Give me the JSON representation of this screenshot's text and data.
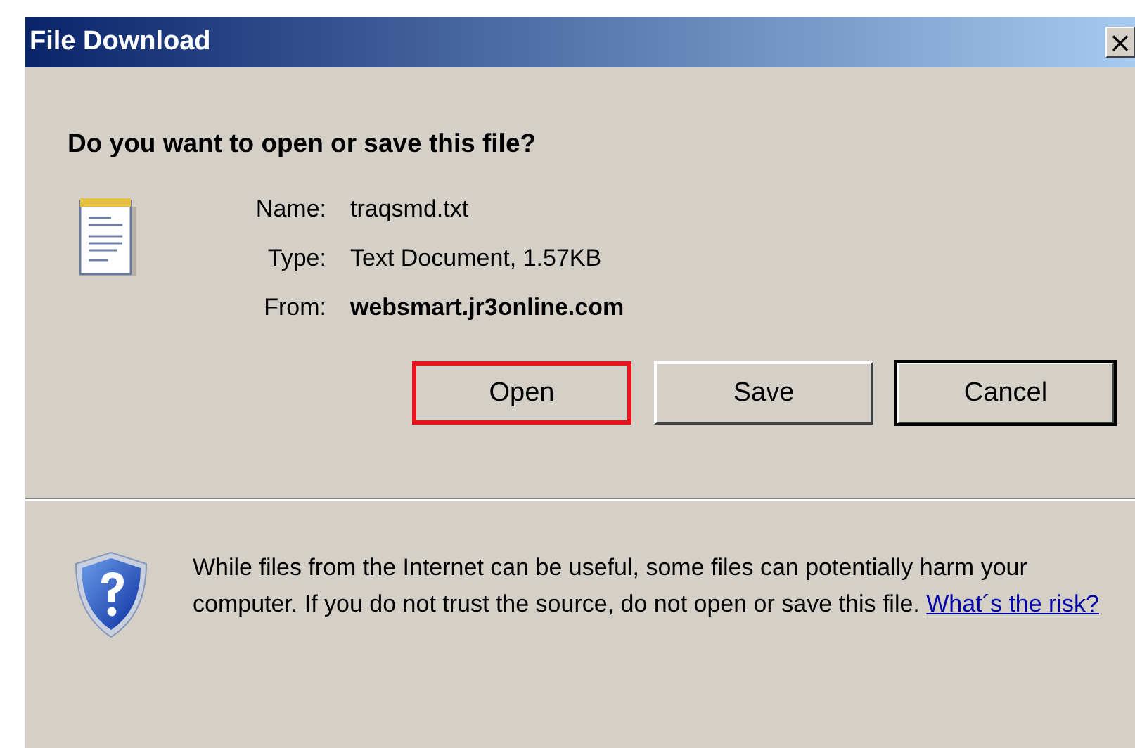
{
  "window": {
    "title": "File Download",
    "close": "×"
  },
  "question": "Do you want to open or save this file?",
  "details": [
    {
      "label": "Name:",
      "value": "traqsmd.txt",
      "kind": "plain"
    },
    {
      "label": "Type:",
      "value": "Text Document, 1.57KB",
      "kind": "plain"
    },
    {
      "label": "From:",
      "value": "websmart.jr3online.com",
      "kind": "bold"
    }
  ],
  "buttons": [
    {
      "label": "Open",
      "highlighted": true,
      "default": false
    },
    {
      "label": "Save",
      "highlighted": false,
      "default": false
    },
    {
      "label": "Cancel",
      "highlighted": false,
      "default": true
    }
  ],
  "warning": {
    "text": "While files from the Internet can be useful, some files can potentially harm your computer. If you do not trust the source, do not open or save this file.",
    "link": "What´s the risk?"
  }
}
